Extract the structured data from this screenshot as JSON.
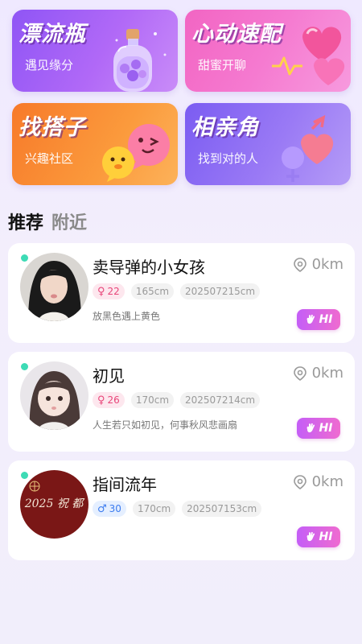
{
  "features": [
    {
      "title": "漂流瓶",
      "subtitle": "遇见缘分"
    },
    {
      "title": "心动速配",
      "subtitle": "甜蜜开聊"
    },
    {
      "title": "找搭子",
      "subtitle": "兴趣社区"
    },
    {
      "title": "相亲角",
      "subtitle": "找到对的人"
    }
  ],
  "tabs": {
    "recommend": "推荐",
    "nearby": "附近"
  },
  "users": [
    {
      "name": "卖导弹的小女孩",
      "distance": "0km",
      "gender": "female",
      "gender_symbol": "♀",
      "age": "22",
      "height": "165cm",
      "id": "202507215cm",
      "bio": "放黑色遇上黄色",
      "hi_label": "HI"
    },
    {
      "name": "初见",
      "distance": "0km",
      "gender": "female",
      "gender_symbol": "♀",
      "age": "26",
      "height": "170cm",
      "id": "202507214cm",
      "bio": "人生若只如初见，何事秋风悲画扇",
      "hi_label": "HI"
    },
    {
      "name": "指间流年",
      "distance": "0km",
      "gender": "male",
      "gender_symbol": "♂",
      "age": "30",
      "height": "170cm",
      "id": "202507153cm",
      "bio": "",
      "hi_label": "HI",
      "avatar_text": "2025 祝 都"
    }
  ],
  "colors": {
    "online": "#3ddbb5",
    "female": "#e8467a",
    "male": "#3b7bef",
    "hi_start": "#c45ef7",
    "hi_end": "#ef6bd0"
  }
}
